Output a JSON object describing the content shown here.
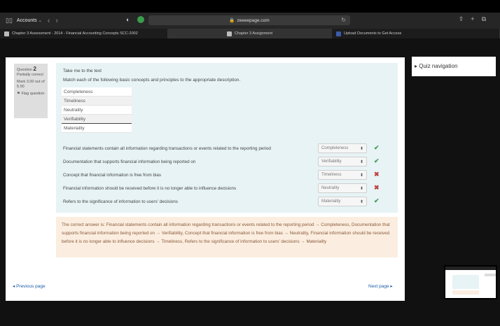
{
  "browser": {
    "accounts_label": "Accounts",
    "url": "zeeeepage.com",
    "tabs": [
      {
        "label": "Chapter 3 Assessment - 2014 - Financial Accounting Concepts SCC-2002"
      },
      {
        "label": "Chapter 3 Assignment"
      },
      {
        "label": "Upload Documents to Get Access"
      }
    ]
  },
  "quiz_nav": {
    "label": "Quiz navigation"
  },
  "question_info": {
    "label": "Question",
    "number": "2",
    "status": "Partially correct",
    "mark": "Mark 3.00 out of 5.00",
    "flag": "Flag question"
  },
  "question": {
    "title": "Take me to the text",
    "instruction": "Match each of the following basic concepts and principles to the appropriate description.",
    "options": [
      "Completeness",
      "Timeliness",
      "Neutrality",
      "Verifiability",
      "Materiality"
    ],
    "rows": [
      {
        "statement": "Financial statements contain all information regarding transactions or events related to the reporting period",
        "selected": "Completeness",
        "correct": true
      },
      {
        "statement": "Documentation that supports financial information being reported on",
        "selected": "Verifiability",
        "correct": true
      },
      {
        "statement": "Concept that financial information is free from bias",
        "selected": "Timeliness",
        "correct": false
      },
      {
        "statement": "Financial information should be received before it is no longer able to influence decisions",
        "selected": "Neutrality",
        "correct": false
      },
      {
        "statement": "Refers to the significance of information to users' decisions",
        "selected": "Materiality",
        "correct": true
      }
    ]
  },
  "feedback": {
    "text": "The correct answer is: Financial statements contain all information regarding transactions or events related to the reporting period → Completeness, Documentation that supports financial information being reported on → Verifiability, Concept that financial information is free from bias → Neutrality, Financial information should be received before it is no longer able to influence decisions → Timeliness, Refers to the significance of information to users' decisions → Materiality"
  },
  "navigation": {
    "prev": "◂ Previous page",
    "next": "Next page ▸"
  },
  "colors": {
    "question_bg": "#e7f3f5",
    "feedback_bg": "#fbeee0",
    "correct": "#4a9a5a",
    "incorrect": "#c04040"
  }
}
